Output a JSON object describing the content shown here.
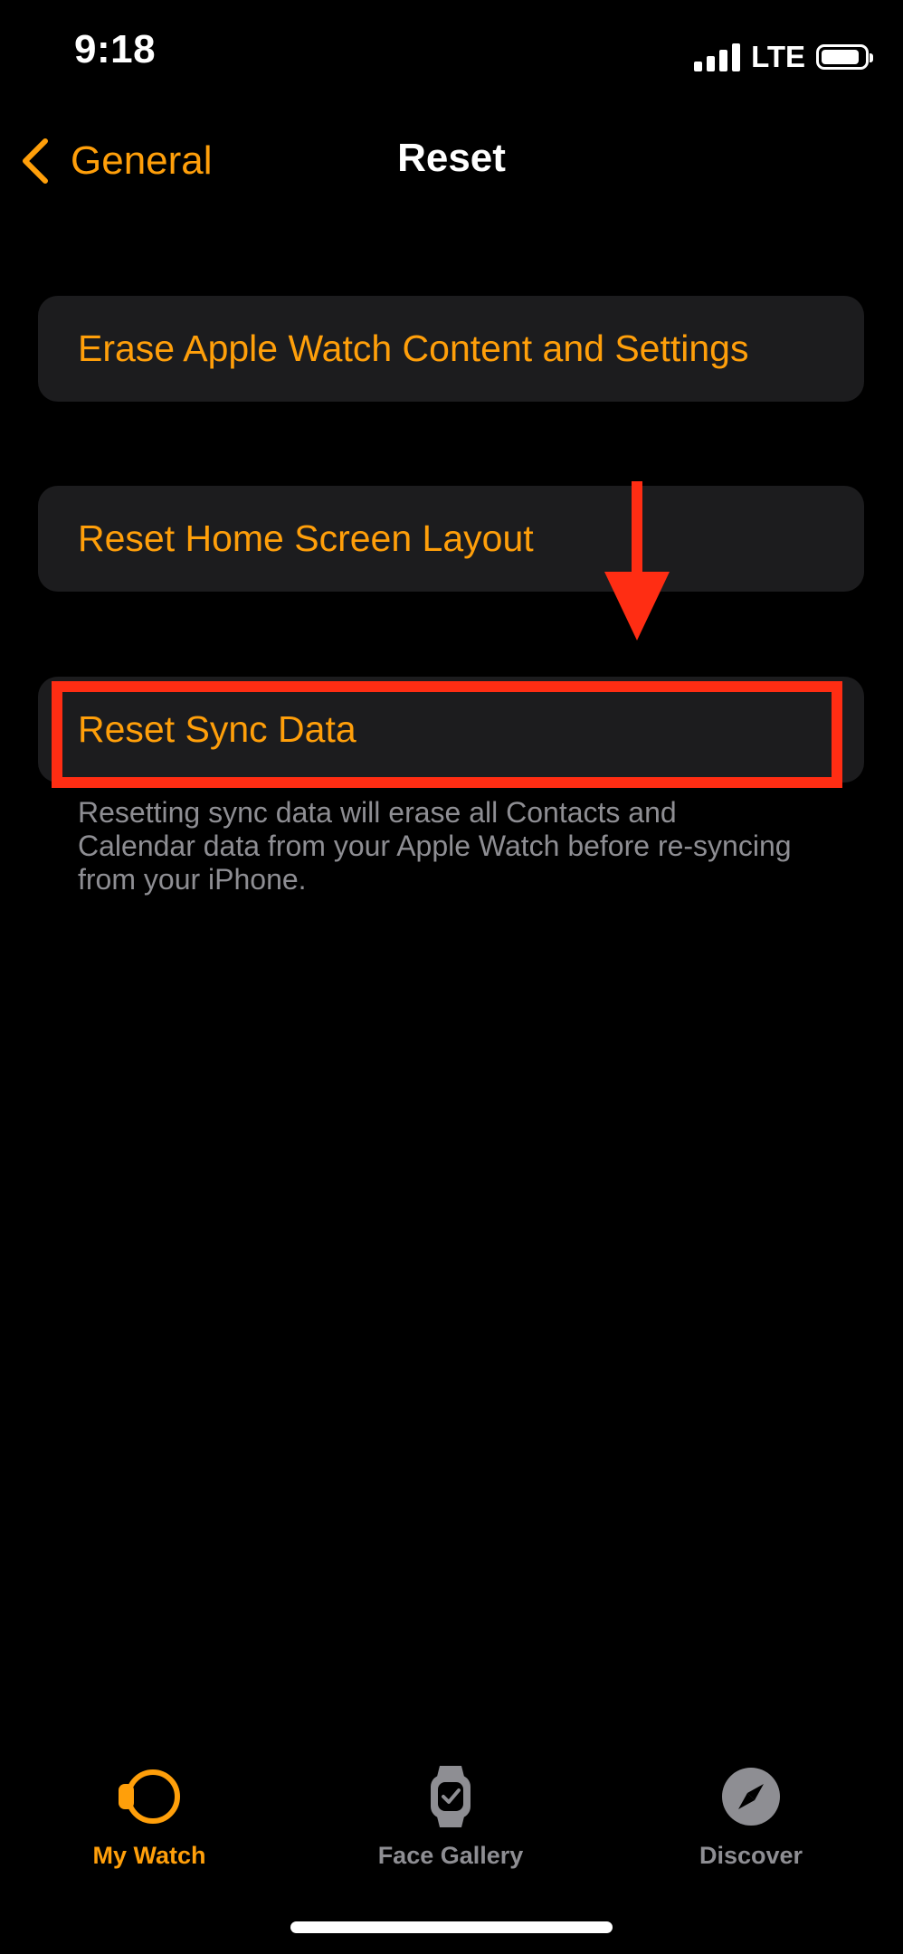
{
  "status_bar": {
    "time": "9:18",
    "network": "LTE",
    "battery_level": 0.9
  },
  "nav": {
    "back_label": "General",
    "title": "Reset"
  },
  "cells": {
    "erase": "Erase Apple Watch Content and Settings",
    "home_layout": "Reset Home Screen Layout",
    "sync_data": "Reset Sync Data"
  },
  "sync_footer": "Resetting sync data will erase all Contacts and Calendar data from your Apple Watch before re-syncing from your iPhone.",
  "tabs": {
    "my_watch": "My Watch",
    "face_gallery": "Face Gallery",
    "discover": "Discover"
  },
  "colors": {
    "accent": "#ff9f0a",
    "cell_background": "#1c1c1e",
    "inactive_tab": "#8e8e93",
    "annotation": "#ff2d13"
  },
  "icons": {
    "back": "chevron-left-icon",
    "my_watch": "watch-face-icon",
    "face_gallery": "watch-icon",
    "discover": "compass-icon"
  }
}
